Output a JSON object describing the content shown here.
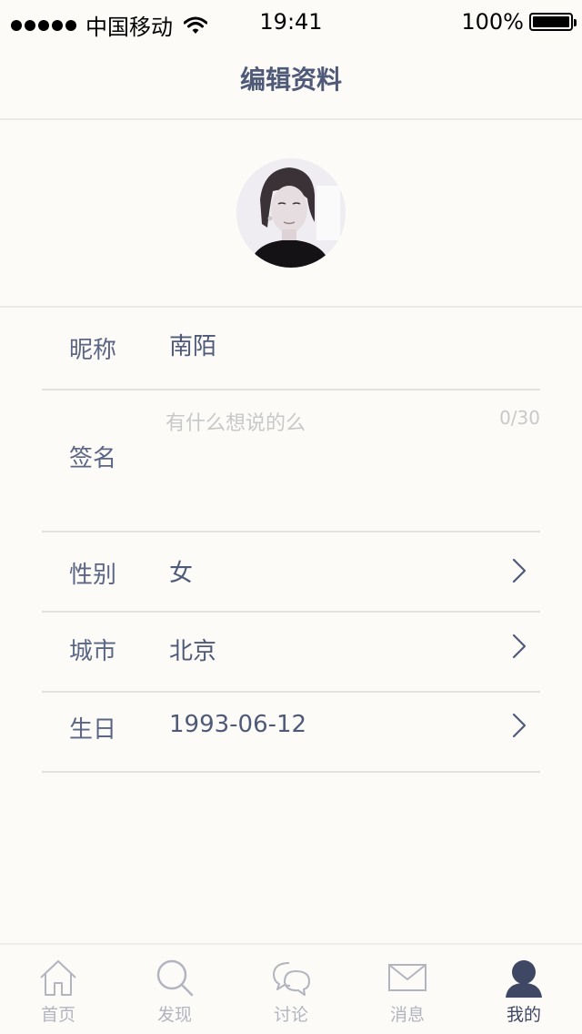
{
  "status_bar": {
    "carrier": "中国移动",
    "time": "19:41",
    "battery": "100%"
  },
  "nav": {
    "title": "编辑资料"
  },
  "profile": {
    "nickname_label": "昵称",
    "nickname_value": "南陌",
    "signature_label": "签名",
    "signature_placeholder": "有什么想说的么",
    "signature_value": "",
    "signature_counter": "0/30",
    "gender_label": "性别",
    "gender_value": "女",
    "city_label": "城市",
    "city_value": "北京",
    "birthday_label": "生日",
    "birthday_value": "1993-06-12"
  },
  "tabs": [
    {
      "label": "首页",
      "icon": "home-icon"
    },
    {
      "label": "发现",
      "icon": "search-icon"
    },
    {
      "label": "讨论",
      "icon": "chat-icon"
    },
    {
      "label": "消息",
      "icon": "mail-icon"
    },
    {
      "label": "我的",
      "icon": "user-icon",
      "active": true
    }
  ],
  "colors": {
    "background": "#fcfbf8",
    "text": "#4e5a78",
    "inactive_tab": "#b2b5bf",
    "active_tab": "#3e4763",
    "divider": "#e3e1dc"
  }
}
